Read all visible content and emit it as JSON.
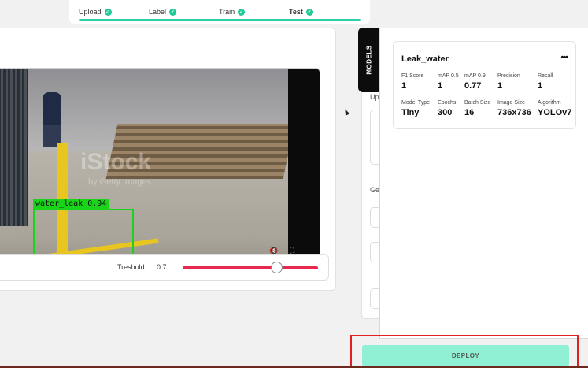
{
  "stepper": {
    "steps": [
      {
        "label": "Upload",
        "done": true
      },
      {
        "label": "Label",
        "done": true
      },
      {
        "label": "Train",
        "done": true
      },
      {
        "label": "Test",
        "done": true,
        "active": true
      }
    ]
  },
  "video": {
    "detection_label": "water_leak  0.94",
    "watermark": "iStock",
    "watermark_sub": "by Getty Images"
  },
  "threshold": {
    "label": "Treshold",
    "value": "0.7",
    "level": 0.7
  },
  "side_panel": {
    "fragment_1": "Up",
    "fragment_2": "Ge"
  },
  "drawer": {
    "tab_label": "MODELS",
    "model": {
      "name": "Leak_water",
      "more": "•••",
      "row1": [
        {
          "key": "F1 Score",
          "value": "1"
        },
        {
          "key": "mAP 0.5",
          "value": "1"
        },
        {
          "key": "mAP 0.9",
          "value": "0.77"
        },
        {
          "key": "Precision",
          "value": "1"
        },
        {
          "key": "Recall",
          "value": "1"
        }
      ],
      "row2": [
        {
          "key": "Model Type",
          "value": "Tiny"
        },
        {
          "key": "Epochs",
          "value": "300"
        },
        {
          "key": "Batch Size",
          "value": "16"
        },
        {
          "key": "Image Size",
          "value": "736x736"
        },
        {
          "key": "Algorithm",
          "value": "YOLOv7"
        }
      ]
    }
  },
  "deploy": {
    "label": "DEPLOY"
  },
  "colors": {
    "accent": "#2bd1a6",
    "slider": "#e7284f",
    "deploy_bg": "#8ff0d3",
    "highlight": "#e02020",
    "bbox": "#19d419"
  }
}
